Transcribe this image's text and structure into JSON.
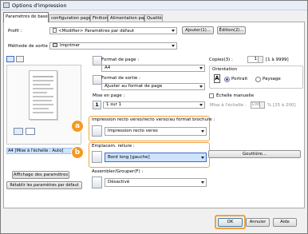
{
  "window": {
    "title": "Options d'impression"
  },
  "tabs": [
    {
      "label": "Paramètres de base"
    },
    {
      "label": "configuration page"
    },
    {
      "label": "Finition"
    },
    {
      "label": "Alimentation papier"
    },
    {
      "label": "Qualité"
    }
  ],
  "profile": {
    "label": "Profil :",
    "value": "<Modifier> Paramètres par défaut",
    "add_button": "Ajouter(1)...",
    "edit_button": "Édition(2)..."
  },
  "output_method": {
    "label": "Méthode de sortie :",
    "value": "Imprimer"
  },
  "preview": {
    "caption": "A4 [Mise à l'échelle : Auto]"
  },
  "left_buttons": {
    "show_settings": "Affichage des paramètres",
    "restore_defaults": "Rétablir les paramètres par défaut"
  },
  "page_format": {
    "label": "Format de page :",
    "value": "A4"
  },
  "output_format": {
    "label": "Format de sortie :",
    "value": "Ajuster au format de page"
  },
  "layout": {
    "label": "Mise en page :",
    "value": "1 sur 1"
  },
  "copies": {
    "label": "Copies(3) :",
    "value": "1",
    "range": "[1 à 9999]"
  },
  "orientation": {
    "label": "Orientation",
    "portrait": "Portrait",
    "landscape": "Paysage",
    "selected": "Portrait"
  },
  "manual_scaling": {
    "label": "Échelle manuelle",
    "scale_label": "Mise à l'échelle :",
    "value": "100",
    "range": "% [25 à 200]"
  },
  "duplex": {
    "label": "Impression recto verso/recto verso/au format brochure :",
    "value": "Impression recto verso",
    "badge": "a"
  },
  "binding": {
    "label": "Emplacem. reliure :",
    "value": "Bord long [gauche]",
    "badge": "b",
    "gutter_button": "Gouttière..."
  },
  "collate": {
    "label": "Assembler/Grouper(F) :",
    "value": "Désactivé"
  },
  "footer": {
    "ok": "OK",
    "cancel": "Annuler",
    "help": "Aide"
  },
  "colors": {
    "accent_orange": "#f39a23",
    "selection_blue": "#cfe3fb"
  }
}
